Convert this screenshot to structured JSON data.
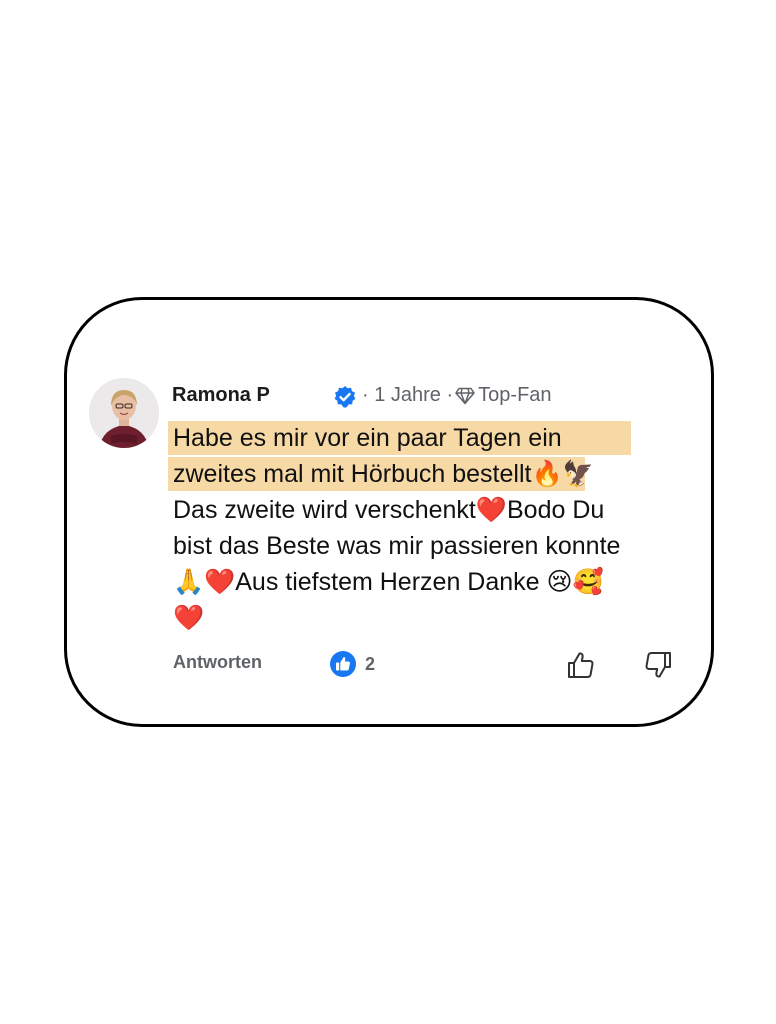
{
  "comment": {
    "author": "Ramona P",
    "time": "· 1 Jahre ·",
    "badge": "Top-Fan",
    "lines": [
      "Habe es mir vor ein paar Tagen ein",
      "zweites mal mit Hörbuch bestellt🔥🦅",
      "Das zweite wird verschenkt❤️Bodo Du",
      "bist das Beste was mir passieren konnte",
      "🙏❤️Aus tiefstem Herzen Danke 😢🥰",
      "❤️"
    ],
    "highlighted_lines": [
      0,
      1
    ]
  },
  "actions": {
    "reply_label": "Antworten",
    "like_count": "2"
  },
  "colors": {
    "highlight": "#f7d9a6",
    "verified": "#1877f2",
    "like_badge": "#1877f2",
    "muted_text": "#5f6368"
  }
}
